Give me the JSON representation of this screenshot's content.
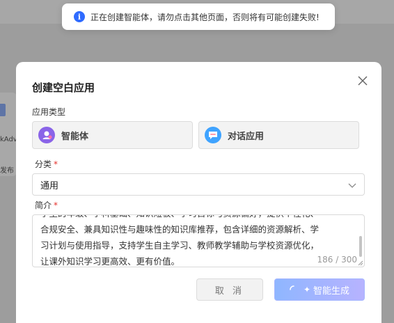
{
  "toast": {
    "icon": "info-icon",
    "message": "正在创建智能体，请勿点击其他页面，否则将有可能创建失败!"
  },
  "background": {
    "snippet_1": "kAdv",
    "snippet_2": "发布"
  },
  "dialog": {
    "title": "创建空白应用",
    "app_type_label": "应用类型",
    "types": [
      {
        "label": "智能体",
        "icon": "robot-avatar-icon"
      },
      {
        "label": "对话应用",
        "icon": "chat-bubble-icon"
      }
    ],
    "category": {
      "label": "分类",
      "required_mark": "*",
      "value": "通用"
    },
    "description": {
      "label": "简介",
      "required_mark": "*",
      "lines": [
        "学生的年级、学科基础、知识短板、学习目标与资源偏好，提供个性化、",
        "合规安全、兼具知识性与趣味性的知识库推荐，包含详细的资源解析、学",
        "习计划与使用指导，支持学生自主学习、教师教学辅助与学校资源优化，",
        "让课外知识学习更高效、更有价值。"
      ],
      "counter": "186 / 300"
    },
    "buttons": {
      "cancel": "取 消",
      "generate": "智能生成"
    }
  },
  "colors": {
    "accent": "#2f6bff",
    "required": "#e5322d",
    "agent_icon": "#8a64e8",
    "chat_icon": "#3fa3ff"
  }
}
